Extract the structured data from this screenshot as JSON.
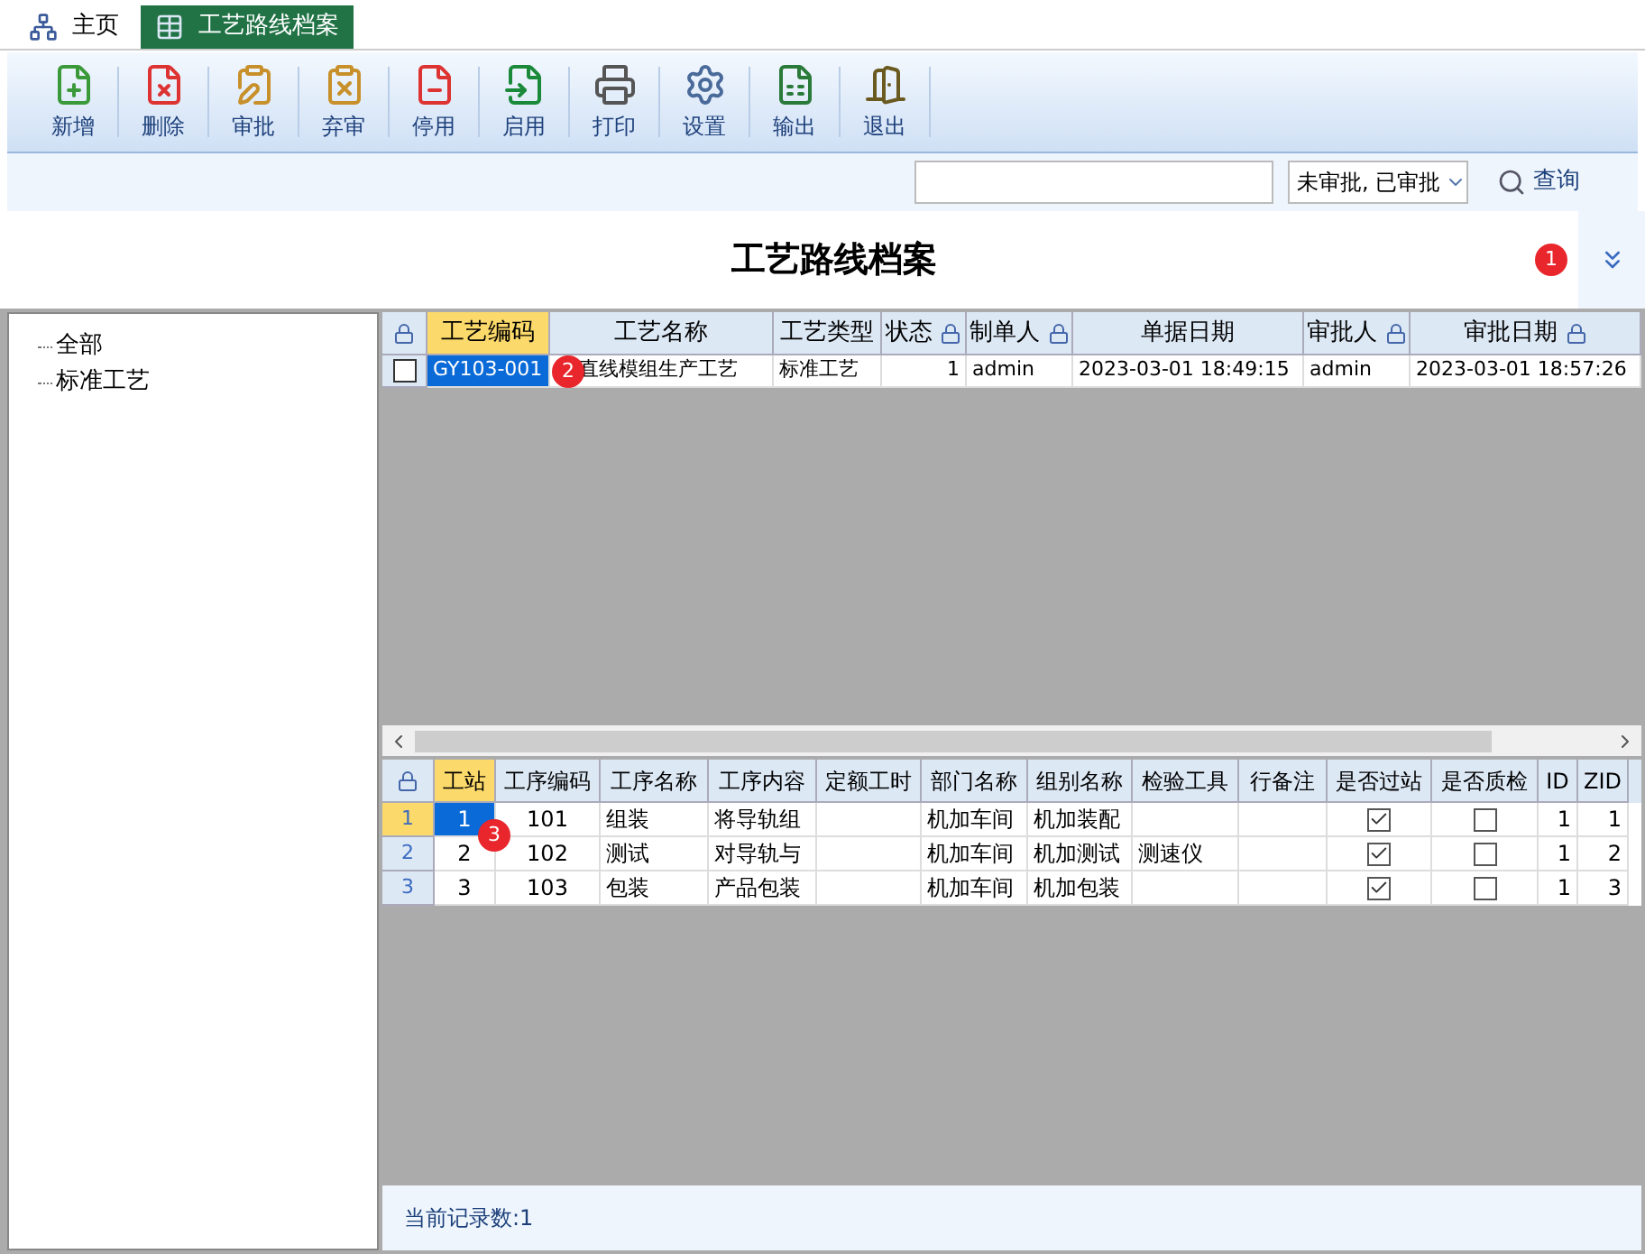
{
  "tabs": [
    {
      "label": "主页",
      "selected": false,
      "kind": "home"
    },
    {
      "label": "工艺路线档案",
      "selected": true,
      "kind": "table"
    }
  ],
  "toolbar": [
    {
      "label": "新增"
    },
    {
      "label": "删除"
    },
    {
      "label": "审批"
    },
    {
      "label": "弃审"
    },
    {
      "label": "停用"
    },
    {
      "label": "启用"
    },
    {
      "label": "打印"
    },
    {
      "label": "设置"
    },
    {
      "label": "输出"
    },
    {
      "label": "退出"
    }
  ],
  "search": {
    "filter": "未审批, 已审批",
    "button": "查询"
  },
  "title": "工艺路线档案",
  "tree": [
    {
      "label": "全部"
    },
    {
      "label": "标准工艺"
    }
  ],
  "main_grid": {
    "columns": [
      {
        "label": "工艺编码",
        "selected": true,
        "locked": false
      },
      {
        "label": "工艺名称",
        "selected": false,
        "locked": false
      },
      {
        "label": "工艺类型",
        "selected": false,
        "locked": false
      },
      {
        "label": "状态",
        "selected": false,
        "locked": true
      },
      {
        "label": "制单人",
        "selected": false,
        "locked": true
      },
      {
        "label": "单据日期",
        "selected": false,
        "locked": false
      },
      {
        "label": "审批人",
        "selected": false,
        "locked": true
      },
      {
        "label": "审批日期",
        "selected": false,
        "locked": true
      }
    ],
    "rows": [
      {
        "checked": false,
        "selected": true,
        "cells": [
          "GY103-001",
          "直线模组生产工艺",
          "标准工艺",
          "1",
          "admin",
          "2023-03-01 18:49:15",
          "admin",
          "2023-03-01 18:57:26"
        ]
      }
    ]
  },
  "detail_grid": {
    "columns": [
      {
        "label": "工站",
        "selected": true
      },
      {
        "label": "工序编码",
        "selected": false
      },
      {
        "label": "工序名称",
        "selected": false
      },
      {
        "label": "工序内容",
        "selected": false
      },
      {
        "label": "定额工时",
        "selected": false
      },
      {
        "label": "部门名称",
        "selected": false
      },
      {
        "label": "组别名称",
        "selected": false
      },
      {
        "label": "检验工具",
        "selected": false
      },
      {
        "label": "行备注",
        "selected": false
      },
      {
        "label": "是否过站",
        "selected": false
      },
      {
        "label": "是否质检",
        "selected": false
      },
      {
        "label": "ID",
        "selected": false
      },
      {
        "label": "ZID",
        "selected": false
      }
    ],
    "rows": [
      {
        "row_number": "1",
        "selected": true,
        "cells": [
          "1",
          "101",
          "组装",
          "将导轨组",
          "",
          "机加车间",
          "机加装配",
          "",
          "",
          {
            "checked": true
          },
          {
            "checked": false
          },
          "1",
          "1"
        ]
      },
      {
        "row_number": "2",
        "selected": false,
        "cells": [
          "2",
          "102",
          "测试",
          "对导轨与",
          "",
          "机加车间",
          "机加测试",
          "测速仪",
          "",
          {
            "checked": true
          },
          {
            "checked": false
          },
          "1",
          "2"
        ]
      },
      {
        "row_number": "3",
        "selected": false,
        "cells": [
          "3",
          "103",
          "包装",
          "产品包装",
          "",
          "机加车间",
          "机加包装",
          "",
          "",
          {
            "checked": true
          },
          {
            "checked": false
          },
          "1",
          "3"
        ]
      }
    ]
  },
  "status_bar": "当前记录数:1",
  "markers": [
    "1",
    "2",
    "3"
  ]
}
